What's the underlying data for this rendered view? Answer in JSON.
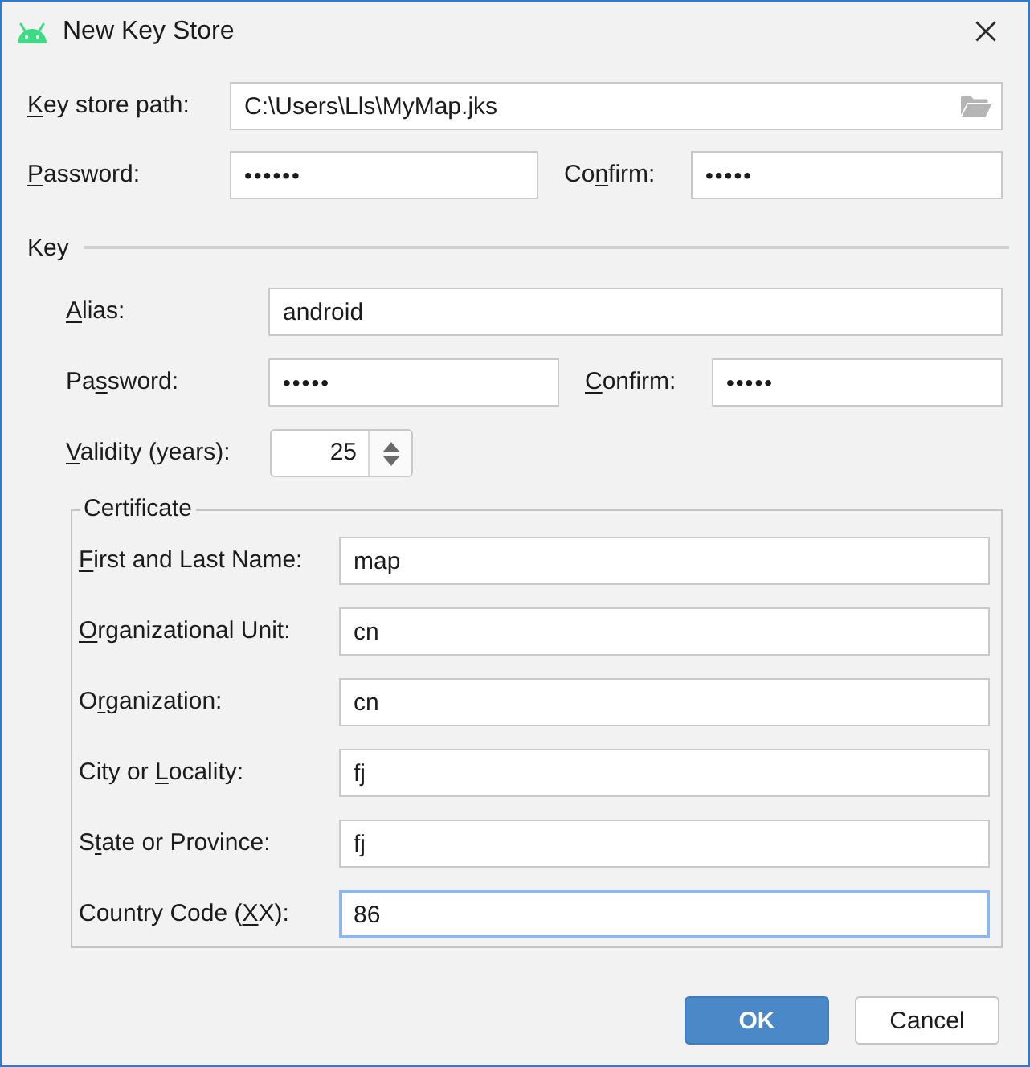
{
  "window": {
    "title": "New Key Store"
  },
  "keystore": {
    "path": {
      "label": {
        "key": "K",
        "post": "ey store path:"
      },
      "value": "C:\\Users\\Lls\\MyMap.jks"
    },
    "password": {
      "label": {
        "key": "P",
        "post": "assword:"
      },
      "value": "••••••"
    },
    "confirm": {
      "label": {
        "pre": "Co",
        "key": "n",
        "post": "firm:"
      },
      "value": "•••••"
    }
  },
  "key": {
    "title": "Key",
    "alias": {
      "label": {
        "key": "A",
        "post": "lias:"
      },
      "value": "android"
    },
    "password": {
      "label": {
        "pre": "Pa",
        "key": "s",
        "post": "sword:"
      },
      "value": "•••••"
    },
    "confirm": {
      "label": {
        "key": "C",
        "post": "onfirm:"
      },
      "value": "•••••"
    },
    "validity": {
      "label": {
        "key": "V",
        "post": "alidity (years):"
      },
      "value": "25"
    },
    "certificate": {
      "title": "Certificate",
      "fields": [
        {
          "label": {
            "key": "F",
            "post": "irst and Last Name:"
          },
          "value": "map",
          "focused": false
        },
        {
          "label": {
            "key": "O",
            "post": "rganizational Unit:"
          },
          "value": "cn",
          "focused": false
        },
        {
          "label": {
            "pre": "O",
            "key": "r",
            "post": "ganization:"
          },
          "value": "cn",
          "focused": false
        },
        {
          "label": {
            "pre": "City or ",
            "key": "L",
            "post": "ocality:"
          },
          "value": "fj",
          "focused": false
        },
        {
          "label": {
            "pre": "S",
            "key": "t",
            "post": "ate or Province:"
          },
          "value": "fj",
          "focused": false
        },
        {
          "label": {
            "pre": "Country Code (",
            "key": "X",
            "post": "X):"
          },
          "value": "86",
          "focused": true
        }
      ]
    }
  },
  "buttons": [
    {
      "label": "OK",
      "default": true
    },
    {
      "label": "Cancel",
      "default": false
    }
  ]
}
